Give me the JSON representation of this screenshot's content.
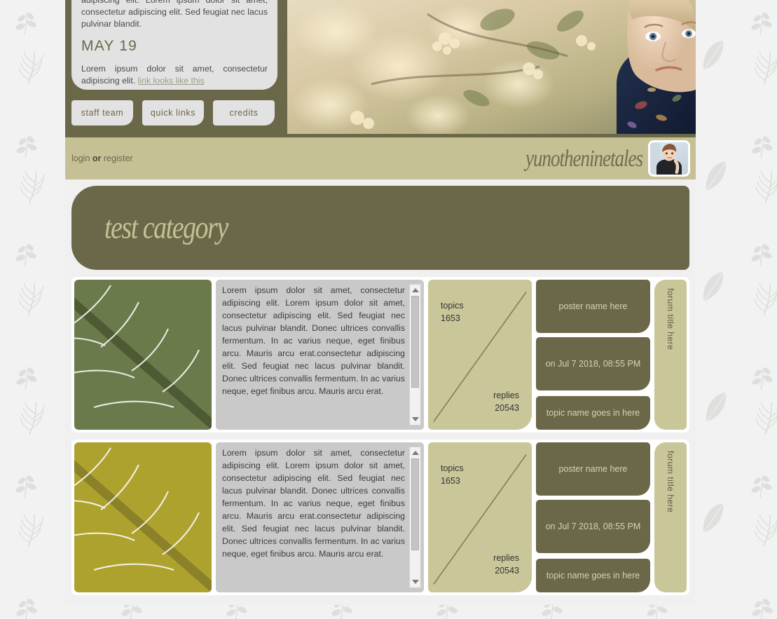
{
  "header": {
    "intro_paragraph": "adipiscing elit. Lorem ipsum dolor sit amet, consectetur adipiscing elit. Sed feugiat nec lacus pulvinar blandit.",
    "date_heading": "MAY 19",
    "second_paragraph": "Lorem ipsum dolor sit amet, consectetur adipiscing elit.",
    "link_text": "link looks like this",
    "buttons": [
      {
        "label": "staff team"
      },
      {
        "label": "quick links"
      },
      {
        "label": "credits"
      }
    ],
    "photo_alt": "blossom-portrait-photo"
  },
  "loginbar": {
    "login_label": "login",
    "or_label": "or",
    "register_label": "register",
    "brand": "yunotheninetales",
    "avatar_alt": "user-avatar-photo"
  },
  "category": {
    "title": "test category"
  },
  "forums": [
    {
      "leaf_color": "#6b7a4a",
      "leaf_vein_color": "#4d5a34",
      "description": "Lorem ipsum dolor sit amet, consectetur adipiscing elit. Lorem ipsum dolor sit amet, consectetur adipiscing elit. Sed feugiat nec lacus pulvinar blandit. Donec ultrices convallis fermentum. In ac varius neque, eget finibus arcu. Mauris arcu erat.consectetur adipiscing elit. Sed feugiat nec lacus pulvinar blandit. Donec ultrices convallis fermentum. In ac varius neque, eget finibus arcu. Mauris arcu erat.",
      "topics_label": "topics",
      "topics_count": "1653",
      "replies_label": "replies",
      "replies_count": "20543",
      "poster_name": "poster name here",
      "post_date": "on Jul 7 2018, 08:55 PM",
      "topic_name": "topic name goes in here",
      "forum_title": "forum title here"
    },
    {
      "leaf_color": "#aea22e",
      "leaf_vein_color": "#8a812a",
      "description": "Lorem ipsum dolor sit amet, consectetur adipiscing elit. Lorem ipsum dolor sit amet, consectetur adipiscing elit. Sed feugiat nec lacus pulvinar blandit. Donec ultrices convallis fermentum. In ac varius neque, eget finibus arcu. Mauris arcu erat.consectetur adipiscing elit. Sed feugiat nec lacus pulvinar blandit. Donec ultrices convallis fermentum. In ac varius neque, eget finibus arcu. Mauris arcu erat.",
      "topics_label": "topics",
      "topics_count": "1653",
      "replies_label": "replies",
      "replies_count": "20543",
      "poster_name": "poster name here",
      "post_date": "on Jul 7 2018, 08:55 PM",
      "topic_name": "topic name goes in here",
      "forum_title": "forum title here"
    }
  ],
  "colors": {
    "dark_olive": "#6b6849",
    "khaki": "#c6c095",
    "stat_khaki": "#c9c69a",
    "page_bg": "#f0f0f0",
    "card_gray": "#e2e2e2",
    "desc_gray": "#c9c9c9"
  }
}
